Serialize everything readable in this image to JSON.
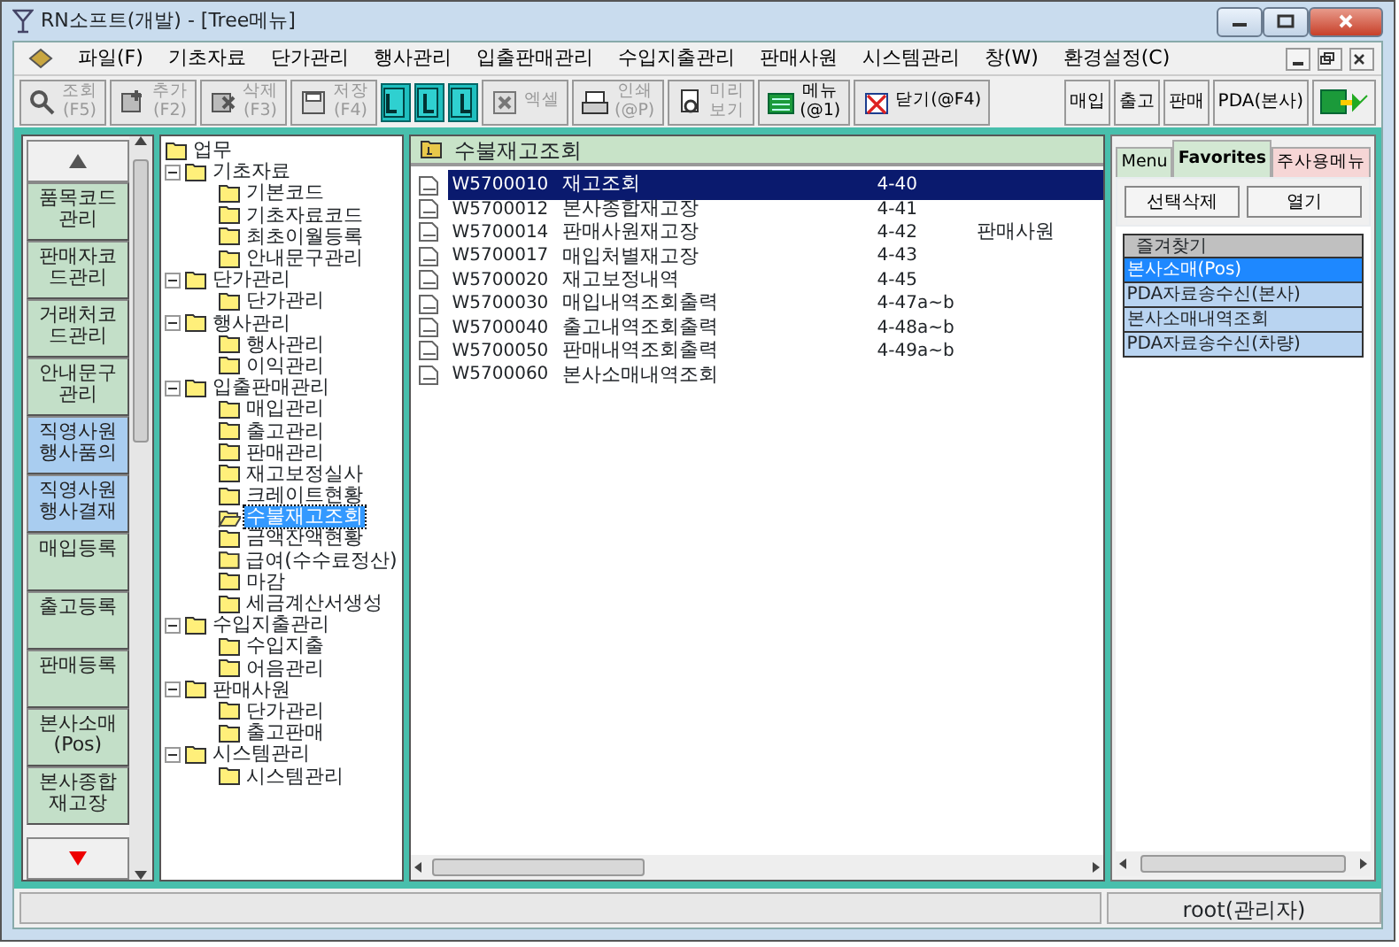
{
  "window": {
    "title": "RN소프트(개발) - [Tree메뉴]"
  },
  "menu": [
    "파일(F)",
    "기초자료",
    "단가관리",
    "행사관리",
    "입출판매관리",
    "수입지출관리",
    "판매사원",
    "시스템관리",
    "창(W)",
    "환경설정(C)"
  ],
  "toolbar": [
    {
      "kind": "button",
      "label": "조회",
      "key": "(F5)",
      "disabled": true
    },
    {
      "kind": "button",
      "label": "추가",
      "key": "(F2)",
      "disabled": true
    },
    {
      "kind": "button",
      "label": "삭제",
      "key": "(F3)",
      "disabled": true
    },
    {
      "kind": "button",
      "label": "저장",
      "key": "(F4)",
      "disabled": true
    },
    {
      "kind": "layout"
    },
    {
      "kind": "layout"
    },
    {
      "kind": "layout"
    },
    {
      "kind": "button",
      "label": "엑셀",
      "disabled": true
    },
    {
      "kind": "button",
      "label": "인쇄",
      "key": "(@P)",
      "disabled": true
    },
    {
      "kind": "button",
      "label": "미리",
      "key": "보기",
      "disabled": true
    },
    {
      "kind": "button",
      "label": "메뉴",
      "key": "(@1)",
      "disabled": false
    },
    {
      "kind": "button",
      "label": "닫기(@F4)",
      "disabled": false
    }
  ],
  "quick_buttons": [
    "매입",
    "출고",
    "판매",
    "PDA(본사)"
  ],
  "side_buttons": [
    {
      "lines": [
        "품목코드",
        "관리"
      ],
      "color": "#c3dfc8"
    },
    {
      "lines": [
        "판매자코",
        "드관리"
      ],
      "color": "#c3dfc8"
    },
    {
      "lines": [
        "거래처코",
        "드관리"
      ],
      "color": "#c3dfc8"
    },
    {
      "lines": [
        "안내문구",
        "관리"
      ],
      "color": "#c3dfc8"
    },
    {
      "lines": [
        "직영사원",
        "행사품의"
      ],
      "color": "#a9cdf0"
    },
    {
      "lines": [
        "직영사원",
        "행사결재"
      ],
      "color": "#a9cdf0"
    },
    {
      "lines": [
        "매입등록"
      ],
      "color": "#c3dfc8"
    },
    {
      "lines": [
        "출고등록"
      ],
      "color": "#c3dfc8"
    },
    {
      "lines": [
        "판매등록"
      ],
      "color": "#c3dfc8"
    },
    {
      "lines": [
        "본사소매",
        "(Pos)"
      ],
      "color": "#c3dfc8"
    },
    {
      "lines": [
        "본사종합",
        "재고장"
      ],
      "color": "#c3dfc8"
    }
  ],
  "tree": [
    {
      "label": "업무",
      "selected": false,
      "children": [
        {
          "label": "기초자료",
          "expanded": true,
          "selected": false,
          "children": [
            {
              "label": "기본코드",
              "selected": false
            },
            {
              "label": "기초자료코드",
              "selected": false
            },
            {
              "label": "최초이월등록",
              "selected": false
            },
            {
              "label": "안내문구관리",
              "selected": false
            }
          ]
        },
        {
          "label": "단가관리",
          "expanded": true,
          "selected": false,
          "children": [
            {
              "label": "단가관리",
              "selected": false
            }
          ]
        },
        {
          "label": "행사관리",
          "expanded": true,
          "selected": false,
          "children": [
            {
              "label": "행사관리",
              "selected": false
            },
            {
              "label": "이익관리",
              "selected": false
            }
          ]
        },
        {
          "label": "입출판매관리",
          "expanded": true,
          "selected": false,
          "children": [
            {
              "label": "매입관리",
              "selected": false
            },
            {
              "label": "출고관리",
              "selected": false
            },
            {
              "label": "판매관리",
              "selected": false
            },
            {
              "label": "재고보정실사",
              "selected": false
            },
            {
              "label": "크레이트현황",
              "selected": false
            },
            {
              "label": "수불재고조회",
              "selected": true
            },
            {
              "label": "금액잔액현황",
              "selected": false
            },
            {
              "label": "급여(수수료정산)",
              "selected": false
            },
            {
              "label": "마감",
              "selected": false
            },
            {
              "label": "세금계산서생성",
              "selected": false
            }
          ]
        },
        {
          "label": "수입지출관리",
          "expanded": true,
          "selected": false,
          "children": [
            {
              "label": "수입지출",
              "selected": false
            },
            {
              "label": "어음관리",
              "selected": false
            }
          ]
        },
        {
          "label": "판매사원",
          "expanded": true,
          "selected": false,
          "children": [
            {
              "label": "단가관리",
              "selected": false
            },
            {
              "label": "출고판매",
              "selected": false
            }
          ]
        },
        {
          "label": "시스템관리",
          "expanded": true,
          "selected": false,
          "children": [
            {
              "label": "시스템관리",
              "selected": false
            }
          ]
        }
      ]
    }
  ],
  "list": {
    "title": "수불재고조회",
    "rows": [
      {
        "code": "W5700010",
        "name": "재고조회",
        "page": "4-40",
        "selected": true
      },
      {
        "code": "W5700012",
        "name": "본사종합재고장",
        "page": "4-41",
        "selected": false
      },
      {
        "code": "W5700014",
        "name": "판매사원재고장",
        "page": "4-42",
        "note": "판매사원",
        "selected": false
      },
      {
        "code": "W5700017",
        "name": "매입처별재고장",
        "page": "4-43",
        "selected": false
      },
      {
        "code": "W5700020",
        "name": "재고보정내역",
        "page": "4-45",
        "selected": false
      },
      {
        "code": "W5700030",
        "name": "매입내역조회출력",
        "page": "4-47a~b",
        "selected": false
      },
      {
        "code": "W5700040",
        "name": "출고내역조회출력",
        "page": "4-48a~b",
        "selected": false
      },
      {
        "code": "W5700050",
        "name": "판매내역조회출력",
        "page": "4-49a~b",
        "selected": false
      },
      {
        "code": "W5700060",
        "name": "본사소매내역조회",
        "selected": false
      }
    ]
  },
  "right_panel": {
    "tabs": [
      {
        "label": "Menu",
        "selected": false,
        "color": "#d3e8d3"
      },
      {
        "label": "Favorites",
        "selected": true,
        "color": "#d3e8d3"
      },
      {
        "label": "주사용메뉴",
        "selected": false,
        "color": "#f6d6d6"
      }
    ],
    "buttons": [
      "선택삭제",
      "열기"
    ],
    "favorites_header": "즐겨찾기",
    "favorites": [
      {
        "label": "본사소매(Pos)",
        "selected": true
      },
      {
        "label": "PDA자료송수신(본사)",
        "selected": false
      },
      {
        "label": "본사소매내역조회",
        "selected": false
      },
      {
        "label": "PDA자료송수신(차량)",
        "selected": false
      }
    ]
  },
  "status_bar": {
    "user": "root(관리자)"
  }
}
